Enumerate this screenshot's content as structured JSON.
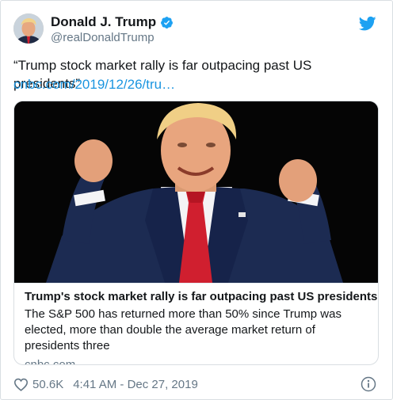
{
  "user": {
    "display_name": "Donald J. Trump",
    "handle": "@realDonaldTrump",
    "verified": true
  },
  "tweet": {
    "text": "“Trump stock market rally is far outpacing past US presidents”",
    "link": "cnbc.com/2019/12/26/tru…"
  },
  "card": {
    "title": "Trump's stock market rally is far outpacing past US presidents",
    "description": "The S&P 500 has returned more than 50% since Trump was elected, more than double the average market return of presidents three",
    "domain": "cnbc.com"
  },
  "footer": {
    "likes": "50.6K",
    "timestamp": "4:41 AM - Dec 27, 2019"
  },
  "icons": {
    "verified": "verified-badge-icon",
    "twitter": "twitter-bird-icon",
    "like": "heart-icon",
    "info": "info-icon"
  },
  "colors": {
    "link": "#1b95e0",
    "secondary_text": "#657786",
    "primary_text": "#14171a",
    "twitter_blue": "#1da1f2"
  }
}
